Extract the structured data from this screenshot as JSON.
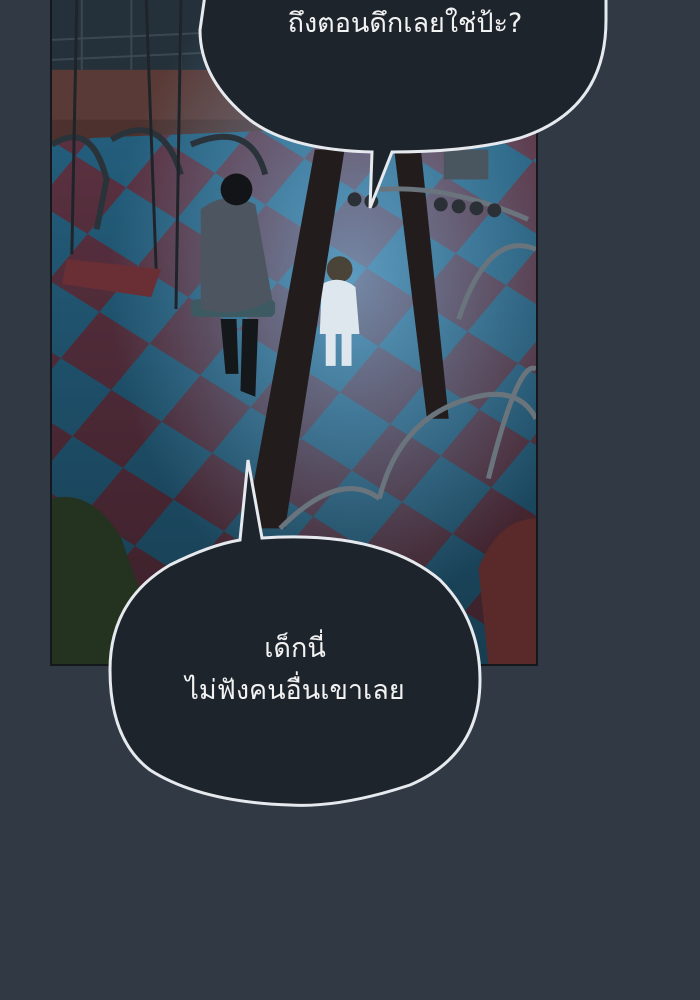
{
  "comic": {
    "top_bubble": {
      "lines": [
        "ถึงตอนดึกเลยใช่ป้ะ?"
      ]
    },
    "bottom_bubble": {
      "lines": [
        "เด็กนี่",
        "ไม่ฟังคนอื่นเขาเลย"
      ]
    }
  },
  "colors": {
    "background": "#313944",
    "bubble_fill": "#1d242c",
    "bubble_outline": "#e6eaee",
    "floor_blue": "#2a6f93",
    "floor_red": "#6b3a4c"
  }
}
